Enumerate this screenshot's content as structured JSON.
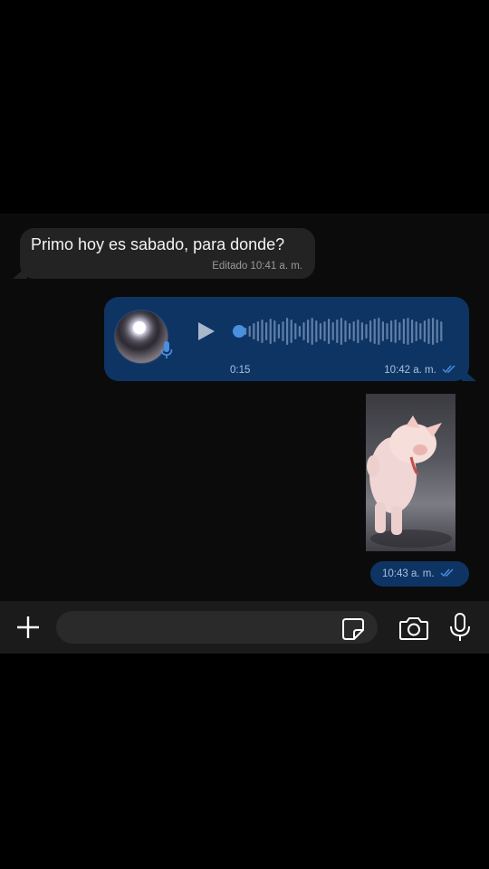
{
  "messages": {
    "incoming": {
      "text": "Primo hoy es sabado, para donde?",
      "meta": "Editado 10:41 a. m."
    },
    "voice": {
      "duration": "0:15",
      "time": "10:42 a. m.",
      "status_icon": "double-check-icon",
      "progress": 0
    },
    "image": {
      "time": "10:43 a. m.",
      "status_icon": "double-check-icon",
      "subject": "pig-photo"
    }
  },
  "input_bar": {
    "placeholder": "",
    "value": "",
    "icons": [
      "plus-icon",
      "sticker-icon",
      "camera-icon",
      "microphone-icon"
    ]
  },
  "colors": {
    "outgoing_bubble": "#0e3464",
    "incoming_bubble": "#232323",
    "accent": "#4a8fe0"
  }
}
